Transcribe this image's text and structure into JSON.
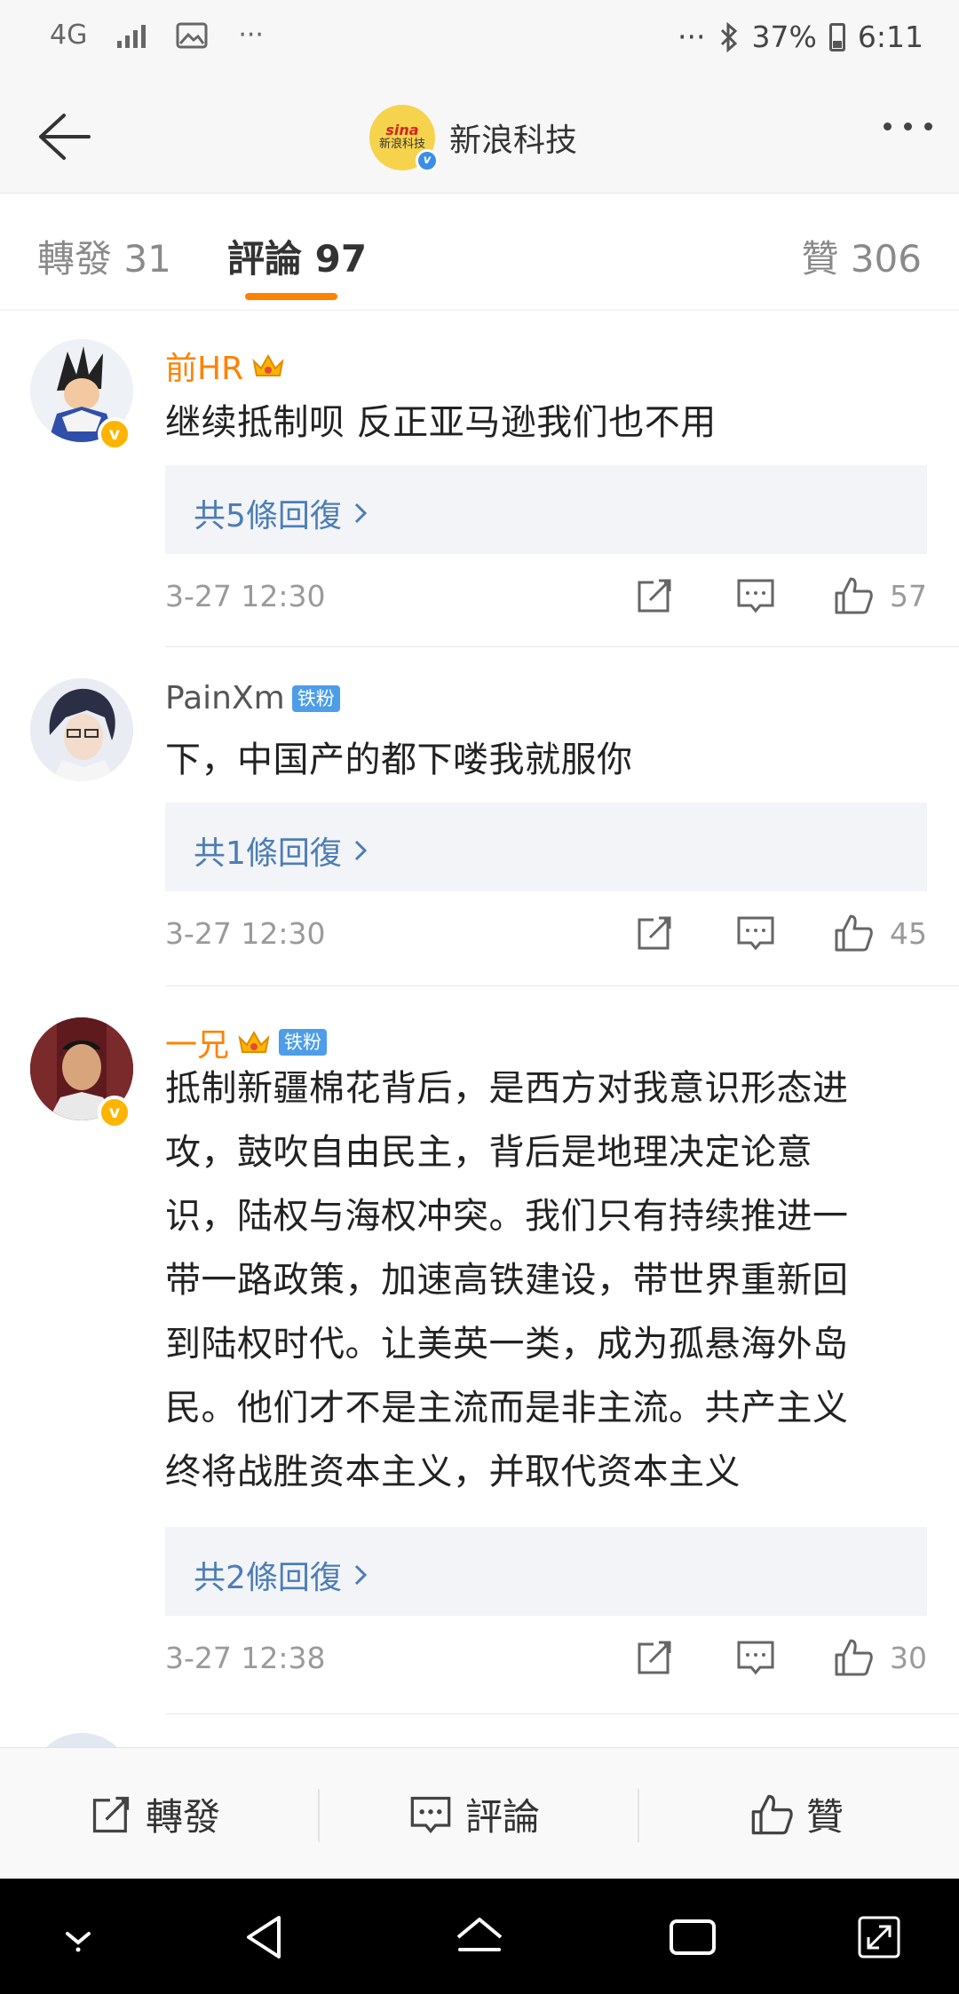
{
  "status_bar": {
    "network": "4G",
    "more_left": "···",
    "more_right": "···",
    "battery": "37%",
    "time": "6:11"
  },
  "header": {
    "account_name": "新浪科技",
    "logo_text": "sina",
    "logo_sub": "新浪科技"
  },
  "tabs": [
    {
      "label": "轉發",
      "count": "31"
    },
    {
      "label": "評論",
      "count": "97",
      "active": true
    },
    {
      "label": "贊",
      "count": "306"
    }
  ],
  "comments": [
    {
      "user": "前HR",
      "name_style": "vip",
      "badges": [
        "crown"
      ],
      "text": "继续抵制呗 反正亚马逊我们也不用",
      "replies": "共5條回復",
      "time": "3-27 12:30",
      "likes": "57"
    },
    {
      "user": "PainXm",
      "name_style": "plain",
      "badges": [
        "铁粉"
      ],
      "text": "下，中国产的都下喽我就服你",
      "replies": "共1條回復",
      "time": "3-27 12:30",
      "likes": "45"
    },
    {
      "user": "一兄",
      "name_style": "vip",
      "badges": [
        "crown",
        "铁粉"
      ],
      "text_lines": [
        "抵制新疆棉花背后，是西方对我意识形态进",
        "攻，鼓吹自由民主，背后是地理决定论意",
        "识，陆权与海权冲突。我们只有持续推进一",
        "带一路政策，加速高铁建设，带世界重新回",
        "到陆权时代。让美英一类，成为孤悬海外岛",
        "民。他们才不是主流而是非主流。共产主义",
        "终将战胜资本主义，并取代资本主义"
      ],
      "replies": "共2條回復",
      "time": "3-27 12:38",
      "likes": "30"
    }
  ],
  "action_bar": {
    "repost": "轉發",
    "comment": "評論",
    "like": "贊"
  },
  "colors": {
    "accent": "#ff8200",
    "link": "#4c7db7",
    "vip_name": "#ff8200",
    "tiefen_badge": "#4d9de8"
  },
  "icons": {
    "repost": "repost-icon",
    "comment": "comment-icon",
    "like": "thumbs-up-icon"
  }
}
